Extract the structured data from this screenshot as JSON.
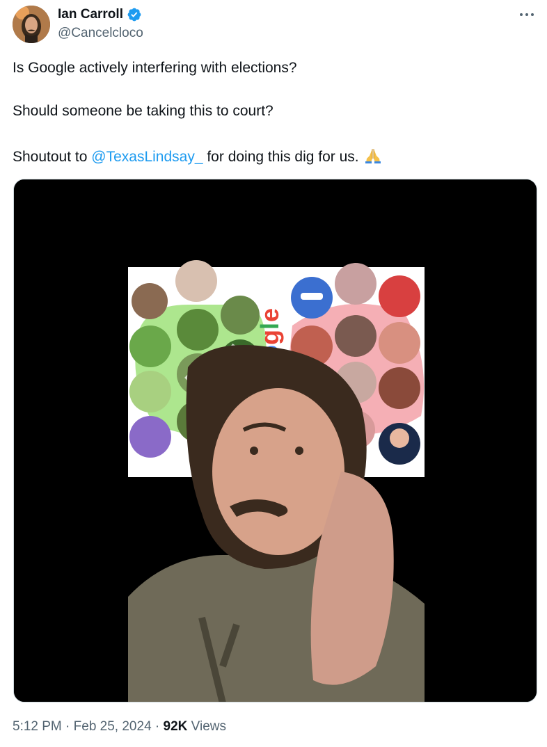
{
  "author": {
    "name": "Ian Carroll",
    "handle": "@Cancelcloco",
    "verified": true
  },
  "tweet": {
    "line1": "Is Google actively interfering with elections?",
    "line2": "Should someone be taking this to court?",
    "line3_prefix": "Shoutout to ",
    "mention": "@TexasLindsay_",
    "line3_suffix": " for doing this dig for us.",
    "emoji": "folded-hands-emoji"
  },
  "media": {
    "logo_text": "ogle",
    "left_group_color": "#7fd45a",
    "right_group_color": "#f3a1a8"
  },
  "meta": {
    "time": "5:12 PM",
    "sep1": " · ",
    "date": "Feb 25, 2024",
    "sep2": " · ",
    "views_count": "92K",
    "views_label": " Views"
  },
  "colors": {
    "link": "#1d9bf0",
    "text": "#0f1419",
    "muted": "#536471"
  }
}
